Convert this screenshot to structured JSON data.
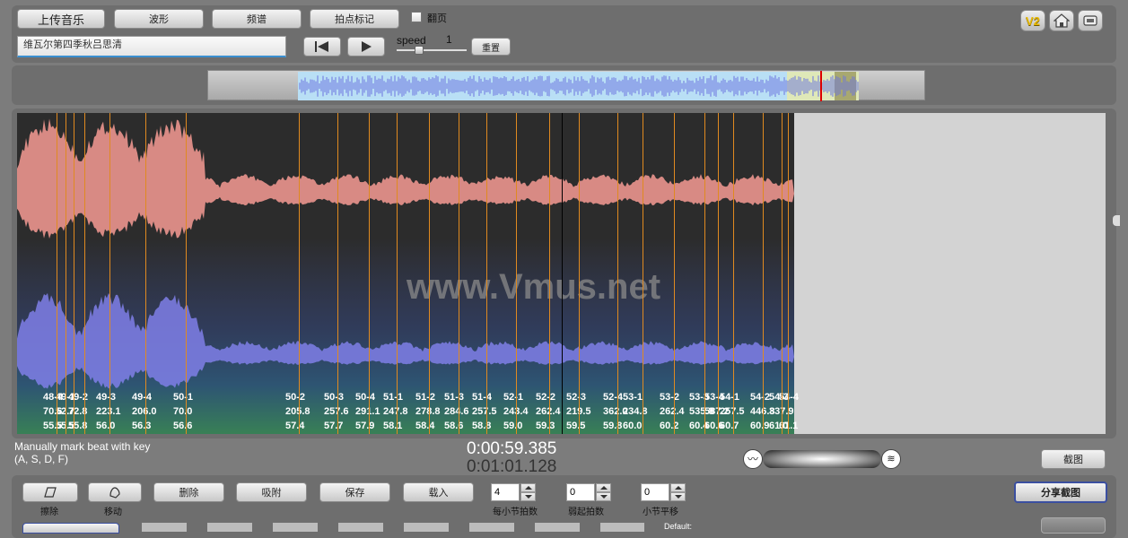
{
  "toolbar": {
    "upload_label": "上传音乐",
    "waveform_label": "波形",
    "spectrum_label": "频谱",
    "beat_label": "拍点标记",
    "flip_label": "翻页",
    "song_title": "维瓦尔第四季秋吕思清",
    "speed_label": "speed",
    "speed_value": "1",
    "reset_label": "重置",
    "v2_label": "V2"
  },
  "watermark": "www.Vmus.net",
  "markers": [
    {
      "lbl": "48-4",
      "v1": "70.6",
      "v2": "55.5"
    },
    {
      "lbl": "49-1",
      "v1": "52.7",
      "v2": "55.5"
    },
    {
      "lbl": "49-2",
      "v1": "72.8",
      "v2": "55.8"
    },
    {
      "lbl": "49-3",
      "v1": "223.1",
      "v2": "56.0"
    },
    {
      "lbl": "49-4",
      "v1": "206.0",
      "v2": "56.3"
    },
    {
      "lbl": "50-1",
      "v1": "70.0",
      "v2": "56.6"
    },
    {
      "lbl": "50-2",
      "v1": "205.8",
      "v2": "57.4"
    },
    {
      "lbl": "50-3",
      "v1": "257.6",
      "v2": "57.7"
    },
    {
      "lbl": "50-4",
      "v1": "291.1",
      "v2": "57.9"
    },
    {
      "lbl": "51-1",
      "v1": "247.8",
      "v2": "58.1"
    },
    {
      "lbl": "51-2",
      "v1": "278.8",
      "v2": "58.4"
    },
    {
      "lbl": "51-3",
      "v1": "284.6",
      "v2": "58.6"
    },
    {
      "lbl": "51-4",
      "v1": "257.5",
      "v2": "58.8"
    },
    {
      "lbl": "52-1",
      "v1": "243.4",
      "v2": "59.0"
    },
    {
      "lbl": "52-2",
      "v1": "262.4",
      "v2": "59.3"
    },
    {
      "lbl": "52-3",
      "v1": "219.5",
      "v2": "59.5"
    },
    {
      "lbl": "52-4",
      "v1": "362.0",
      "v2": "59.8"
    },
    {
      "lbl": "53-1",
      "v1": "234.8",
      "v2": "60.0"
    },
    {
      "lbl": "53-2",
      "v1": "262.4",
      "v2": "60.2"
    },
    {
      "lbl": "53-3",
      "v1": "535.8",
      "v2": "60.4"
    },
    {
      "lbl": "53-4",
      "v1": "587.2",
      "v2": "60.6"
    },
    {
      "lbl": "54-1",
      "v1": "257.5",
      "v2": "60.7"
    },
    {
      "lbl": "54-2",
      "v1": "446.8",
      "v2": "60.9"
    },
    {
      "lbl": "54-3",
      "v1": "337.9",
      "v2": "61.0"
    },
    {
      "lbl": "54-4",
      "v1": "",
      "v2": "61.1"
    }
  ],
  "status": {
    "hint_line1": "Manually mark beat with key",
    "hint_line2": "(A, S, D, F)",
    "current_time": "0:00:59.385",
    "total_time": "0:01:01.128",
    "screenshot_label": "截图"
  },
  "bottom": {
    "erase_label": "擦除",
    "move_label": "移动",
    "delete_label": "删除",
    "snap_label": "吸附",
    "save_label": "保存",
    "load_label": "载入",
    "beats_per_bar_value": "4",
    "beats_per_bar_label": "每小节拍数",
    "pickup_value": "0",
    "pickup_label": "弱起拍数",
    "bar_shift_value": "0",
    "bar_shift_label": "小节平移",
    "share_label": "分享截图",
    "default_label": "Default:"
  }
}
